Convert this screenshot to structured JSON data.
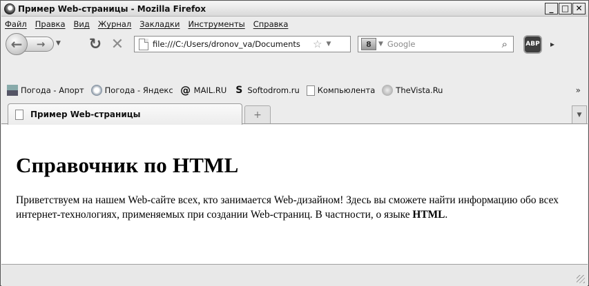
{
  "window": {
    "title": "Пример Web-страницы - Mozilla Firefox",
    "buttons": {
      "minimize": "_",
      "maximize": "□",
      "close": "✕"
    }
  },
  "menu": [
    {
      "label": "Файл"
    },
    {
      "label": "Правка"
    },
    {
      "label": "Вид"
    },
    {
      "label": "Журнал"
    },
    {
      "label": "Закладки"
    },
    {
      "label": "Инструменты"
    },
    {
      "label": "Справка"
    }
  ],
  "nav": {
    "url": "file:///C:/Users/dronov_va/Documents",
    "search_placeholder": "Google"
  },
  "bookmarks": [
    {
      "label": "Погода - Апорт",
      "icon": "weather-image-icon"
    },
    {
      "label": "Погода - Яндекс",
      "icon": "weather-cloud-icon"
    },
    {
      "label": "MAIL.RU",
      "icon": "at-sign-icon"
    },
    {
      "label": "Softodrom.ru",
      "icon": "softodrom-icon"
    },
    {
      "label": "Компьюлента",
      "icon": "page-icon"
    },
    {
      "label": "TheVista.Ru",
      "icon": "vista-icon"
    }
  ],
  "tabs": [
    {
      "label": "Пример Web-страницы",
      "active": true
    }
  ],
  "page": {
    "heading": "Справочник по HTML",
    "paragraph_prefix": "Приветствуем на нашем Web-сайте всех, кто занимается Web-дизайном! Здесь вы сможете найти информацию обо всех интернет-технологиях, применяемых при создании Web-страниц. В частности, о языке ",
    "paragraph_bold": "HTML",
    "paragraph_suffix": "."
  }
}
